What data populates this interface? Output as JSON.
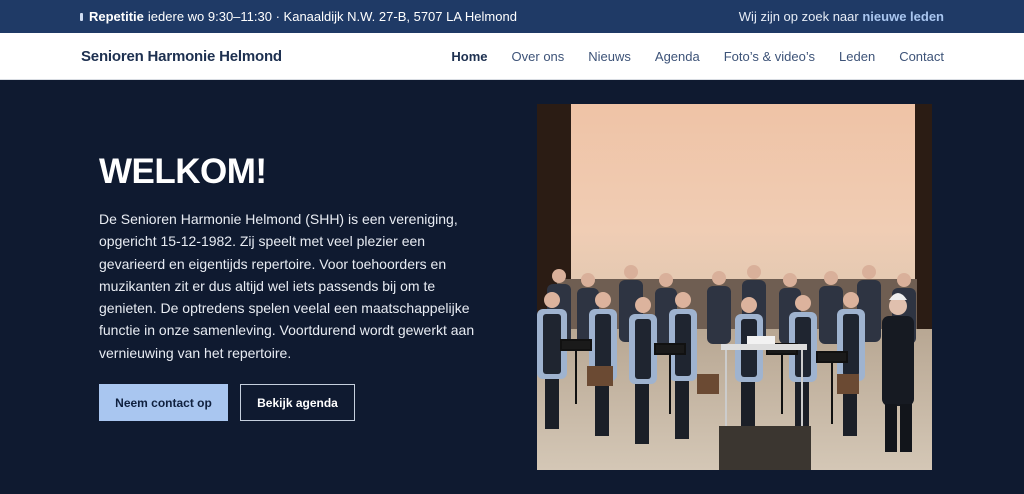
{
  "topbar": {
    "rehearsal_label": "Repetitie",
    "rehearsal_text": "iedere wo 9:30–11:30 · Kanaaldijk N.W. 27-B, 5707 LA Helmond",
    "recruit_text": "Wij zijn op zoek naar",
    "recruit_link": "nieuwe leden"
  },
  "nav": {
    "brand": "Senioren Harmonie Helmond",
    "items": [
      {
        "label": "Home",
        "active": true
      },
      {
        "label": "Over ons"
      },
      {
        "label": "Nieuws"
      },
      {
        "label": "Agenda"
      },
      {
        "label": "Foto’s & video’s"
      },
      {
        "label": "Leden"
      },
      {
        "label": "Contact"
      }
    ]
  },
  "hero": {
    "title": "WELKOM!",
    "intro": "De Senioren Harmonie Helmond (SHH) is een vereniging, opgericht 15-12-1982. Zij speelt met veel plezier een gevarieerd en eigentijds repertoire. Voor toehoorders en muzikanten zit er dus altijd wel iets passends bij om te genieten. De optredens spelen veelal een maatschappelijke functie in onze samenleving. Voortdurend wordt gewerkt aan vernieuwing van het repertoire.",
    "primary_button": "Neem contact op",
    "secondary_button": "Bekijk agenda"
  },
  "colors": {
    "topbar_bg": "#1f3a66",
    "hero_bg": "#0f1a30",
    "accent": "#a9c6f0",
    "brand_text": "#1d3050"
  }
}
